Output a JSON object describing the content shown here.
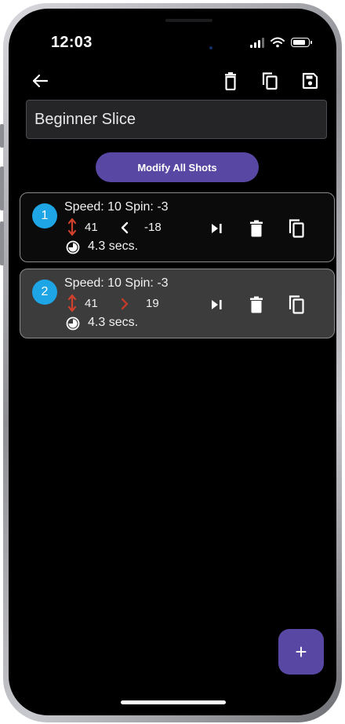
{
  "status_bar": {
    "time": "12:03",
    "icons": [
      "signal-icon",
      "wifi-icon",
      "battery-icon"
    ]
  },
  "app_bar": {
    "icons": [
      "back-arrow-icon",
      "trash-icon",
      "copy-icon",
      "save-icon"
    ]
  },
  "routine_name": {
    "value": "Beginner Slice"
  },
  "modify_all_button": {
    "label": "Modify All Shots"
  },
  "shots": [
    {
      "number": "1",
      "speed_spin": "Speed: 10 Spin: -3",
      "elevation": "41",
      "direction_icon": "chevron-left-icon",
      "direction": "-18",
      "duration": "4.3 secs."
    },
    {
      "number": "2",
      "speed_spin": "Speed: 10 Spin: -3",
      "elevation": "41",
      "direction_icon": "chevron-right-icon",
      "direction": "19",
      "duration": "4.3 secs."
    }
  ],
  "fab": {
    "label": "+"
  },
  "colors": {
    "background": "#000000",
    "accent": "#5848a4",
    "shot_badge": "#1ea5e6",
    "elevation_icon": "#d0402c",
    "right_direction_icon": "#c23a2a",
    "card_border": "#8a8a8f",
    "selected_card_background": "#3c3c3c"
  }
}
